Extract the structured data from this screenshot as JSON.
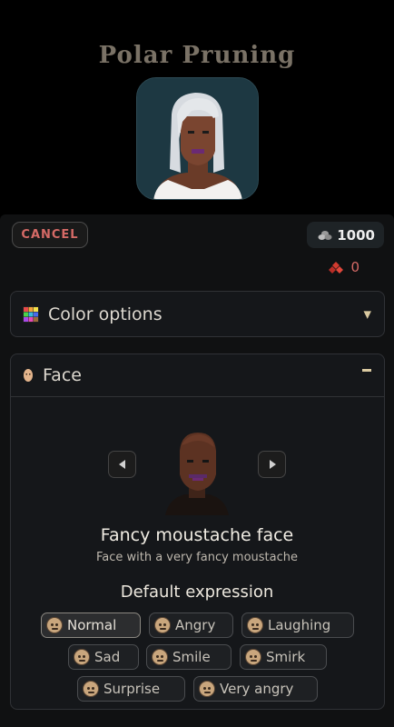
{
  "header": {
    "title": "Polar Pruning"
  },
  "toolbar": {
    "cancel_label": "CANCEL",
    "coins": "1000",
    "gems": "0"
  },
  "color_section": {
    "label": "Color options",
    "icon": "palette-grid-icon",
    "expanded": false
  },
  "face_section": {
    "label": "Face",
    "icon": "face-icon",
    "expanded": true,
    "selected_face_name": "Fancy moustache face",
    "selected_face_description": "Face with a very fancy moustache",
    "expression_title": "Default expression",
    "expressions": [
      {
        "label": "Normal",
        "selected": true
      },
      {
        "label": "Angry",
        "selected": false
      },
      {
        "label": "Laughing",
        "selected": false
      },
      {
        "label": "Sad",
        "selected": false
      },
      {
        "label": "Smile",
        "selected": false
      },
      {
        "label": "Smirk",
        "selected": false
      },
      {
        "label": "Surprise",
        "selected": false
      },
      {
        "label": "Very angry",
        "selected": false
      }
    ]
  },
  "colors": {
    "accent_red": "#d56a66",
    "caret": "#d9c9a0",
    "portrait_bg": "#1d3842"
  }
}
